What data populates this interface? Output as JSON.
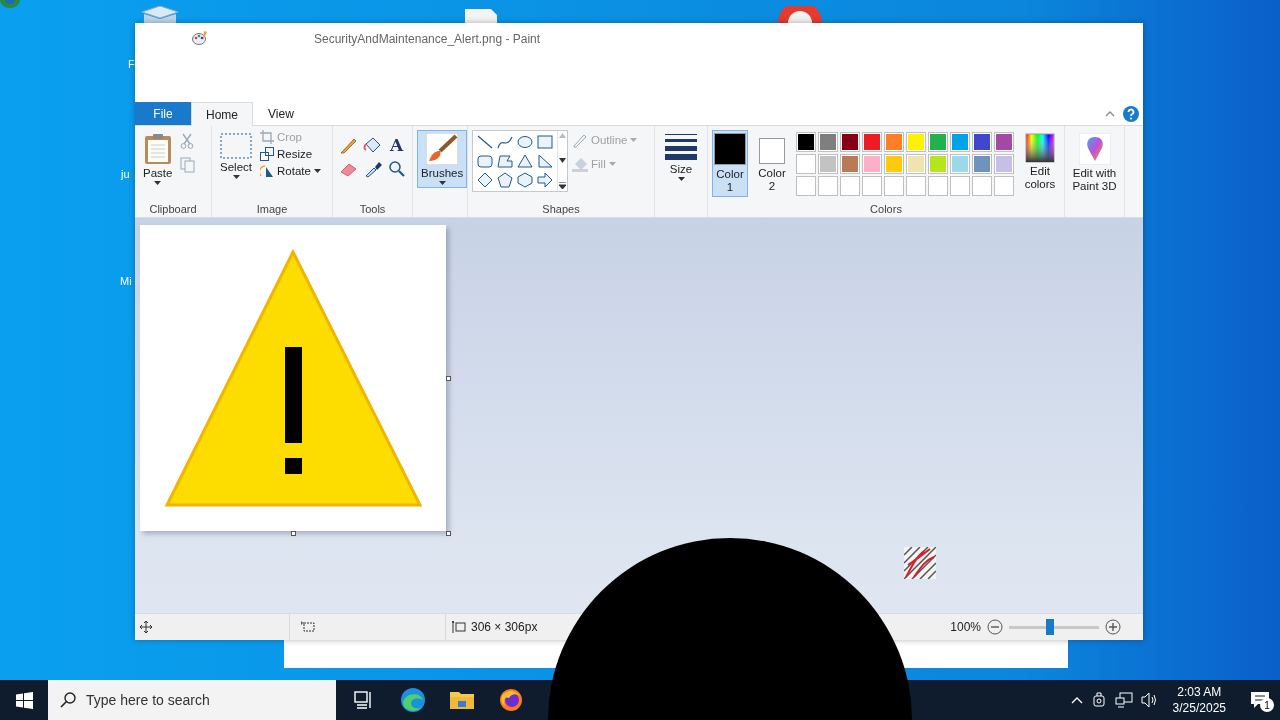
{
  "desktop_icons": [
    {
      "label": "F"
    },
    {
      "label": "ju"
    },
    {
      "label": "Mi"
    }
  ],
  "window": {
    "title": "SecurityAndMaintenance_Alert.png - Paint"
  },
  "tabs": [
    {
      "label": "File",
      "kind": "file",
      "selected": false
    },
    {
      "label": "Home",
      "kind": "tab",
      "selected": true
    },
    {
      "label": "View",
      "kind": "tab",
      "selected": false
    }
  ],
  "clipboard": {
    "label": "Clipboard",
    "paste": "Paste"
  },
  "image": {
    "label": "Image",
    "select": "Select",
    "commands": [
      {
        "label": "Crop",
        "disabled": true,
        "dropdown": false
      },
      {
        "label": "Resize",
        "disabled": false,
        "dropdown": false
      },
      {
        "label": "Rotate",
        "disabled": false,
        "dropdown": true
      }
    ]
  },
  "tools": {
    "label": "Tools",
    "text_glyph": "A"
  },
  "brushes": {
    "label": "Brushes",
    "selected": true
  },
  "shapes": {
    "label": "Shapes",
    "commands": [
      {
        "label": "Outline",
        "disabled": true,
        "dropdown": true
      },
      {
        "label": "Fill",
        "disabled": true,
        "dropdown": true
      }
    ]
  },
  "size": {
    "label": "Size"
  },
  "colors": {
    "label": "Colors",
    "color1": {
      "label": "Color 1",
      "color": "#000000",
      "selected": true
    },
    "color2": {
      "label": "Color 2",
      "color": "#ffffff",
      "selected": false
    },
    "palette": [
      {
        "color": "#000000"
      },
      {
        "color": "#7f7f7f"
      },
      {
        "color": "#880015"
      },
      {
        "color": "#ed1c24"
      },
      {
        "color": "#ff7f27"
      },
      {
        "color": "#fff200"
      },
      {
        "color": "#22b14c"
      },
      {
        "color": "#00a2e8"
      },
      {
        "color": "#3f48cc"
      },
      {
        "color": "#a349a4"
      },
      {
        "color": "#ffffff"
      },
      {
        "color": "#c3c3c3"
      },
      {
        "color": "#b97a57"
      },
      {
        "color": "#ffaec9"
      },
      {
        "color": "#ffc90e"
      },
      {
        "color": "#efe4b0"
      },
      {
        "color": "#b5e61d"
      },
      {
        "color": "#99d9ea"
      },
      {
        "color": "#7092be"
      },
      {
        "color": "#c8bfe7"
      }
    ],
    "edit_colors": "Edit colors"
  },
  "paint3d": {
    "label": "Edit with Paint 3D"
  },
  "status_bar": {
    "image_size": "306 × 306px",
    "zoom": "100%",
    "zoom_slider": {
      "level": 0.45
    }
  },
  "taskbar": {
    "search": {
      "placeholder": "Type here to search"
    },
    "time": "2:03 AM",
    "date": "3/25/2025",
    "notifications": "1"
  }
}
